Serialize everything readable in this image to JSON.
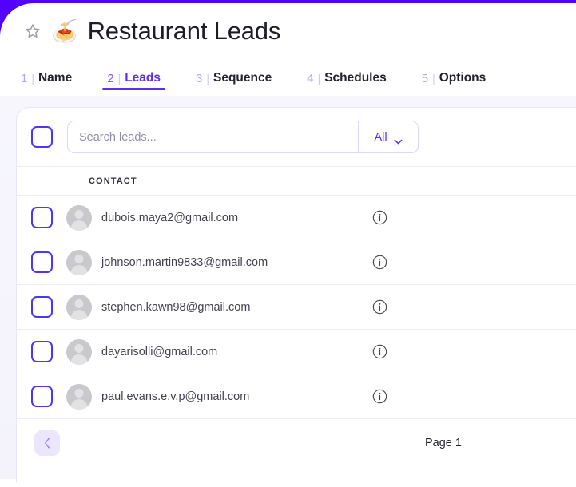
{
  "header": {
    "star_icon": "star-outline-icon",
    "emoji": "🍝",
    "title": "Restaurant Leads"
  },
  "tabs": [
    {
      "num": "1",
      "sep": "|",
      "label": "Name",
      "active": false
    },
    {
      "num": "2",
      "sep": "|",
      "label": "Leads",
      "active": true
    },
    {
      "num": "3",
      "sep": "|",
      "label": "Sequence",
      "active": false
    },
    {
      "num": "4",
      "sep": "|",
      "label": "Schedules",
      "active": false
    },
    {
      "num": "5",
      "sep": "|",
      "label": "Options",
      "active": false
    }
  ],
  "toolbar": {
    "select_all_checkbox": "unchecked",
    "search_placeholder": "Search leads...",
    "search_value": "",
    "filter_label": "All",
    "filter_icon": "chevron-down-icon",
    "filter_options": [
      "All"
    ]
  },
  "table": {
    "columns": [
      "CONTACT"
    ],
    "rows": [
      {
        "checkbox": "unchecked",
        "avatar": "avatar-placeholder",
        "email": "dubois.maya2@gmail.com",
        "info_icon": "info-circle-icon"
      },
      {
        "checkbox": "unchecked",
        "avatar": "avatar-placeholder",
        "email": "johnson.martin9833@gmail.com",
        "info_icon": "info-circle-icon"
      },
      {
        "checkbox": "unchecked",
        "avatar": "avatar-placeholder",
        "email": "stephen.kawn98@gmail.com",
        "info_icon": "info-circle-icon"
      },
      {
        "checkbox": "unchecked",
        "avatar": "avatar-placeholder",
        "email": "dayarisolli@gmail.com",
        "info_icon": "info-circle-icon"
      },
      {
        "checkbox": "unchecked",
        "avatar": "avatar-placeholder",
        "email": "paul.evans.e.v.p@gmail.com",
        "info_icon": "info-circle-icon"
      }
    ]
  },
  "pagination": {
    "prev_icon": "chevron-left-icon",
    "page_label": "Page 1"
  },
  "colors": {
    "brand_purple": "#5200ff",
    "accent_violet": "#5b2ef0",
    "checkbox_blue": "#4b36f3",
    "tab_number_muted": "#b9a4f5",
    "page_tint": "#f6f5fd"
  }
}
